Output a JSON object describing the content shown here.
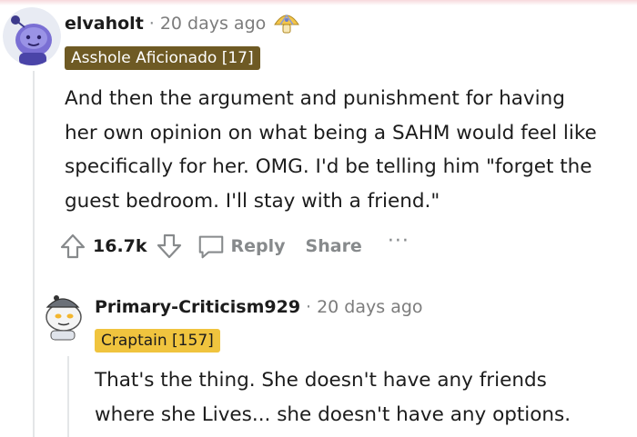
{
  "comment": {
    "username": "elvaholt",
    "separator": "·",
    "timestamp": "20 days ago",
    "award_icon": "mushroom-award-icon",
    "flair": "Asshole Aficionado [17]",
    "body_lines": [
      "And then the argument and punishment for having",
      "her own opinion on what being a SAHM would feel like",
      "specifically for her. OMG. I'd be telling him \"forget the",
      "guest bedroom. I'll stay with a friend.\""
    ],
    "actions": {
      "score": "16.7k",
      "reply_label": "Reply",
      "share_label": "Share",
      "more_label": "···"
    }
  },
  "reply": {
    "username": "Primary-Criticism929",
    "separator": "·",
    "timestamp": "20 days ago",
    "flair": "Craptain [157]",
    "body_lines": [
      "That's the thing. She doesn't have any friends",
      "where she Lives... she doesn't have any options."
    ]
  },
  "colors": {
    "flair1_bg": "#6e5a24",
    "flair2_bg": "#f0c43e",
    "muted": "#878a8c",
    "text": "#1c1c1c"
  }
}
